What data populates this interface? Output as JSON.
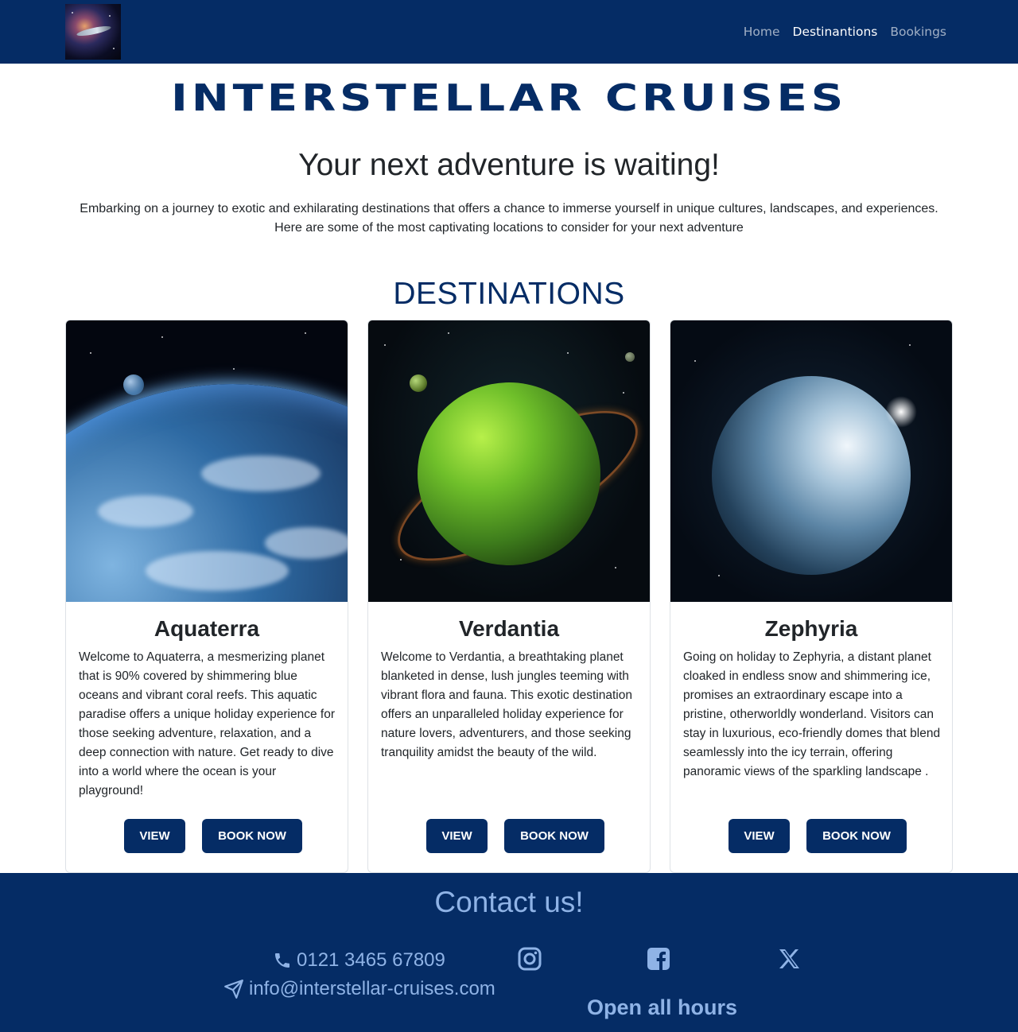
{
  "nav": {
    "logo_alt": "Interstellar Cruises logo",
    "links": [
      {
        "label": "Home",
        "active": false
      },
      {
        "label": "Destinantions",
        "active": true
      },
      {
        "label": "Bookings",
        "active": false
      }
    ]
  },
  "hero": {
    "brand": "INTERSTELLAR CRUISES",
    "tagline": "Your next adventure is waiting!",
    "intro": "Embarking on a journey to exotic and exhilarating destinations that offers a chance to immerse yourself in unique cultures, landscapes, and experiences. Here are some of the most captivating locations to consider for your next adventure"
  },
  "destinations": {
    "title": "DESTINATIONS",
    "cards": [
      {
        "name": "Aquaterra",
        "image_icon": "ocean-planet-image",
        "description": "Welcome to Aquaterra, a mesmerizing planet that is 90% covered by shimmering blue oceans and vibrant coral reefs. This aquatic paradise offers a unique holiday experience for those seeking adventure, relaxation, and a deep connection with nature. Get ready to dive into a world where the ocean is your playground!",
        "view_label": "VIEW",
        "book_label": "BOOK NOW"
      },
      {
        "name": "Verdantia",
        "image_icon": "jungle-planet-image",
        "description": "Welcome to Verdantia, a breathtaking planet blanketed in dense, lush jungles teeming with vibrant flora and fauna. This exotic destination offers an unparalleled holiday experience for nature lovers, adventurers, and those seeking tranquility amidst the beauty of the wild.",
        "view_label": "VIEW",
        "book_label": "BOOK NOW"
      },
      {
        "name": "Zephyria",
        "image_icon": "ice-planet-image",
        "description": "Going on holiday to Zephyria, a distant planet cloaked in endless snow and shimmering ice, promises an extraordinary escape into a pristine, otherworldly wonderland. Visitors can stay in luxurious, eco-friendly domes that blend seamlessly into the icy terrain, offering panoramic views of the sparkling landscape .",
        "view_label": "VIEW",
        "book_label": "BOOK NOW"
      }
    ]
  },
  "footer": {
    "title": "Contact us!",
    "phone": "0121 3465 67809",
    "email": "info@interstellar-cruises.com",
    "hours": "Open all hours",
    "socials": [
      "instagram-icon",
      "facebook-icon",
      "x-icon"
    ]
  },
  "colors": {
    "primary": "#052c65",
    "footer_text": "#8fb3e6"
  }
}
